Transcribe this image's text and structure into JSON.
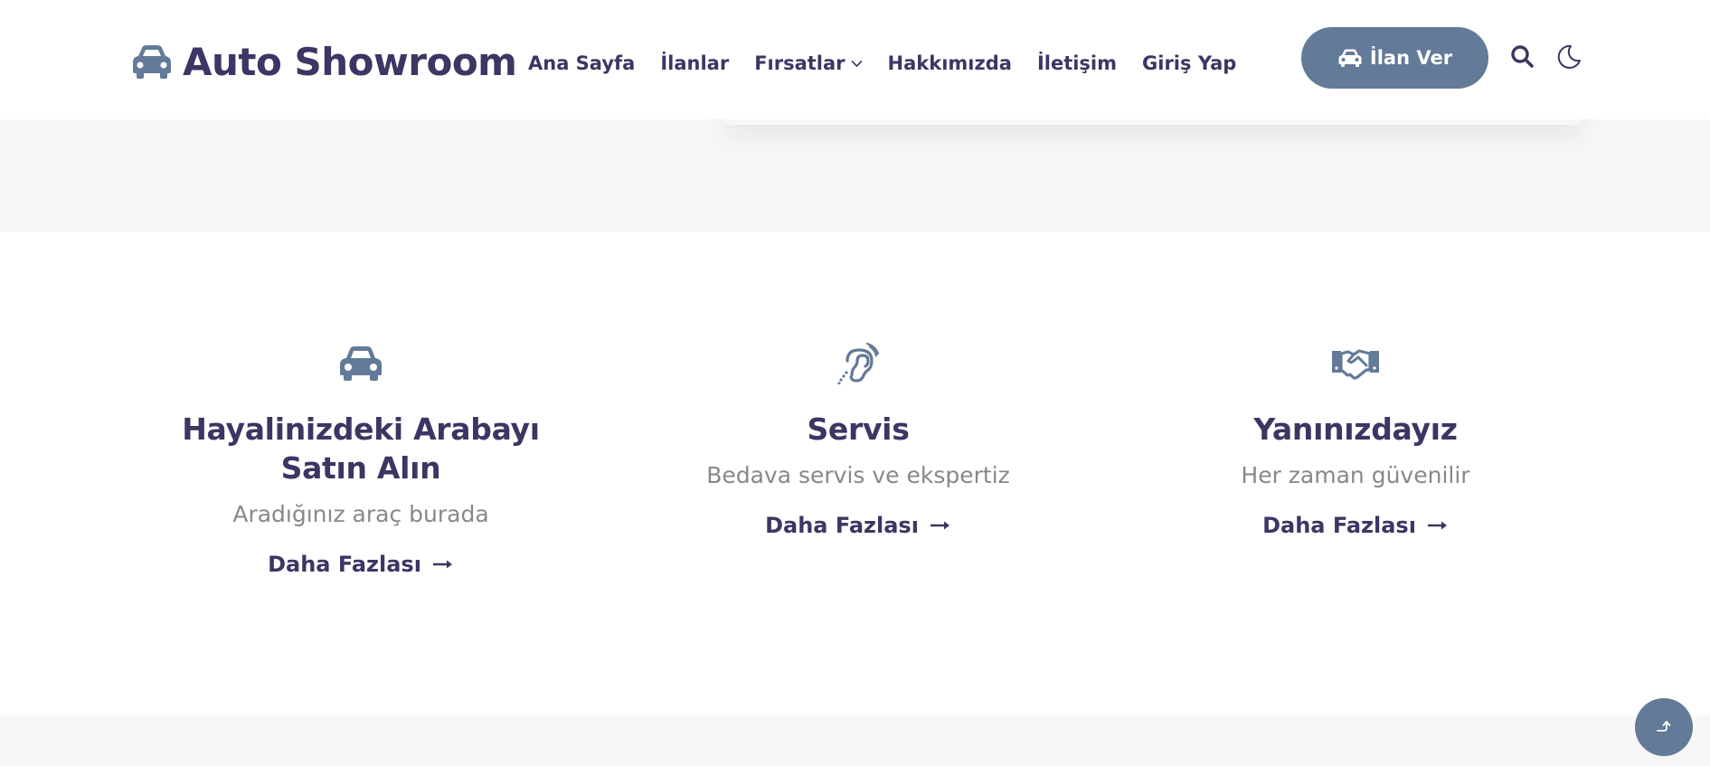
{
  "header": {
    "logo_text": "Auto Showroom",
    "logo_icon": "car-icon",
    "nav": [
      {
        "label": "Ana Sayfa"
      },
      {
        "label": "İlanlar"
      },
      {
        "label": "Fırsatlar",
        "icon": "chevron-down-icon"
      },
      {
        "label": "Hakkımızda"
      },
      {
        "label": "İletişim"
      },
      {
        "label": "Giriş Yap"
      }
    ],
    "cta_label": "İlan Ver",
    "cta_icon": "car-icon",
    "search_icon": "search-icon",
    "theme_icon": "moon-icon"
  },
  "features": [
    {
      "icon": "car-icon",
      "title": "Hayalinizdeki Arabayı Satın Alın",
      "text": "Aradığınız araç burada",
      "link": "Daha Fazlası"
    },
    {
      "icon": "ear-icon",
      "title": "Servis",
      "text": "Bedava servis ve ekspertiz",
      "link": "Daha Fazlası"
    },
    {
      "icon": "handshake-icon",
      "title": "Yanınızdayız",
      "text": "Her zaman güvenilir",
      "link": "Daha Fazlası"
    }
  ],
  "scroll_top_icon": "arrow-up-icon",
  "colors": {
    "primary_text": "#3b3663",
    "accent": "#637a98",
    "muted_text": "#888888",
    "band_bg": "#f7f7f7"
  }
}
